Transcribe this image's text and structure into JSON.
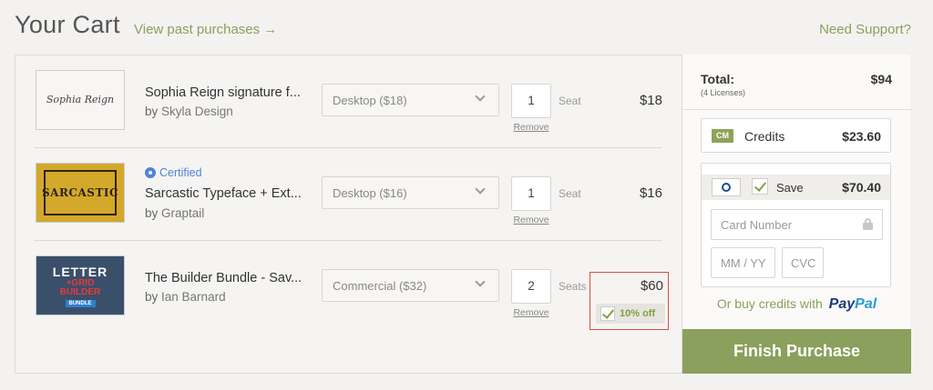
{
  "header": {
    "title": "Your Cart",
    "past_link": "View past purchases →",
    "support_link": "Need Support?"
  },
  "items": [
    {
      "thumb_text": "Sophia Reign",
      "thumb_sub": "",
      "name": "Sophia Reign signature f...",
      "by": "by",
      "author": "Skyla Design",
      "license": "Desktop ($18)",
      "qty": "1",
      "seat_label": "Seat",
      "remove": "Remove",
      "price": "$18"
    },
    {
      "certified": "Certified",
      "thumb_text": "SARCASTIC",
      "name": "Sarcastic Typeface + Ext...",
      "by": "by",
      "author": "Graptail",
      "license": "Desktop ($16)",
      "qty": "1",
      "seat_label": "Seat",
      "remove": "Remove",
      "price": "$16"
    },
    {
      "thumb_l1": "LETTER",
      "thumb_l2": "+GRID",
      "thumb_l2b": "BUILDER",
      "thumb_l3": "BUNDLE",
      "name": "The Builder Bundle - Sav...",
      "by": "by",
      "author": "Ian Barnard",
      "license": "Commercial ($32)",
      "qty": "2",
      "seat_label": "Seats",
      "remove": "Remove",
      "price": "$60",
      "discount": "10% off"
    }
  ],
  "sidebar": {
    "total_label": "Total:",
    "total_sub": "(4 Licenses)",
    "total_value": "$94",
    "credits_badge": "CM",
    "credits_label": "Credits",
    "credits_value": "$23.60",
    "save_label": "Save",
    "saved_value": "$70.40",
    "card_placeholder": "Card Number",
    "expiry_placeholder": "MM / YY",
    "cvc_placeholder": "CVC",
    "paypal_prefix": "Or buy credits with",
    "paypal_pay": "Pay",
    "paypal_pal": "Pal",
    "finish_button": "Finish Purchase"
  },
  "colors": {
    "accent_green": "#8ba05c",
    "certified_blue": "#4f84d6",
    "highlight_red": "#e24b3b"
  }
}
